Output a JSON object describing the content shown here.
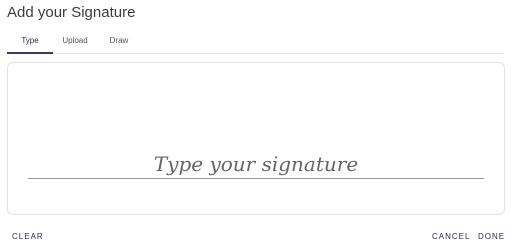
{
  "dialog": {
    "title": "Add your Signature"
  },
  "tabs": [
    {
      "label": "Type",
      "active": true
    },
    {
      "label": "Upload",
      "active": false
    },
    {
      "label": "Draw",
      "active": false
    }
  ],
  "signature": {
    "value": "",
    "placeholder": "Type your signature"
  },
  "actions": {
    "clear_label": "CLEAR",
    "cancel_label": "CANCEL",
    "done_label": "DONE"
  },
  "colors": {
    "accent": "#2e2a5a",
    "tab_indicator": "#3b3670"
  }
}
